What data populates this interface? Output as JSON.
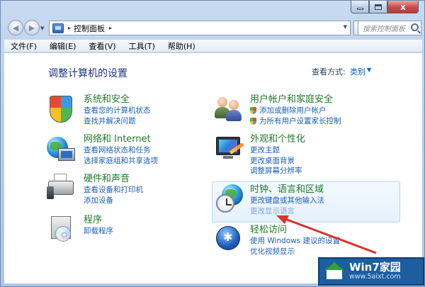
{
  "window": {
    "caption": {
      "minimize": "",
      "maximize": "",
      "close": "x"
    }
  },
  "navbar": {
    "back": "◀",
    "forward": "▶",
    "address": {
      "crumb": "控制面板",
      "arrow": "▸"
    },
    "refresh": "⟳",
    "search_placeholder": "搜索控制面板"
  },
  "menubar": [
    "文件(F)",
    "编辑(E)",
    "查看(V)",
    "工具(T)",
    "帮助(H)"
  ],
  "content": {
    "heading": "调整计算机的设置",
    "view_by_label": "查看方式:",
    "view_by_value": "类别",
    "categories_left": [
      {
        "title": "系统和安全",
        "icon": "shield-icon",
        "links": [
          "查看您的计算机状态",
          "查找并解决问题"
        ]
      },
      {
        "title": "网络和 Internet",
        "icon": "network-globe-icon",
        "links": [
          "查看网络状态和任务",
          "选择家庭组和共享选项"
        ]
      },
      {
        "title": "硬件和声音",
        "icon": "printer-icon",
        "links": [
          "查看设备和打印机",
          "添加设备"
        ]
      },
      {
        "title": "程序",
        "icon": "programs-icon",
        "links": [
          "卸载程序"
        ]
      }
    ],
    "categories_right": [
      {
        "title": "用户帐户和家庭安全",
        "icon": "users-icon",
        "links": [
          "添加或删除用户帐户",
          "为所有用户设置家长控制"
        ]
      },
      {
        "title": "外观和个性化",
        "icon": "appearance-icon",
        "links": [
          "更改主题",
          "更改桌面背景",
          "调整屏幕分辨率"
        ]
      },
      {
        "title": "时钟、语言和区域",
        "icon": "clock-globe-icon",
        "links": [
          "更改键盘或其他输入法",
          "更改显示语言"
        ]
      },
      {
        "title": "轻松访问",
        "icon": "ease-of-access-icon",
        "links": [
          "使用 Windows 建议的设置",
          "优化视频显示"
        ]
      }
    ]
  },
  "watermark": {
    "title": "Win7家园",
    "url": "www.5aixt.com"
  },
  "colors": {
    "title_green": "#1f7a2a",
    "link_blue": "#1d5fb9",
    "heading_blue": "#1e3287",
    "arrow_red": "#d9342b"
  }
}
